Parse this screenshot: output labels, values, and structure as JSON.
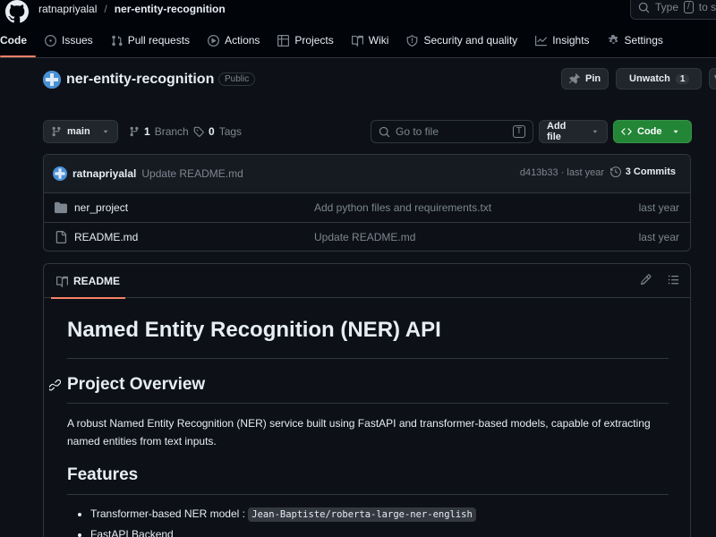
{
  "header": {
    "owner": "ratnapriyalal",
    "separator": "/",
    "repo": "ner-entity-recognition",
    "search_label": "Type",
    "search_key": "/",
    "search_suffix": "to se"
  },
  "tabs": [
    {
      "label": "Code",
      "icon": "code-icon"
    },
    {
      "label": "Issues",
      "icon": "issue-icon"
    },
    {
      "label": "Pull requests",
      "icon": "pull-request-icon"
    },
    {
      "label": "Actions",
      "icon": "play-icon"
    },
    {
      "label": "Projects",
      "icon": "table-icon"
    },
    {
      "label": "Wiki",
      "icon": "book-icon"
    },
    {
      "label": "Security and quality",
      "icon": "shield-icon"
    },
    {
      "label": "Insights",
      "icon": "graph-icon"
    },
    {
      "label": "Settings",
      "icon": "gear-icon"
    }
  ],
  "repo": {
    "name": "ner-entity-recognition",
    "visibility": "Public",
    "pin_label": "Pin",
    "watch_label": "Unwatch",
    "watch_count": "1"
  },
  "branch_bar": {
    "branch": "main",
    "branch_count": "1",
    "branch_label": "Branch",
    "tag_count": "0",
    "tag_label": "Tags",
    "goto_placeholder": "Go to file",
    "goto_key": "T",
    "add_file_label": "Add file",
    "code_label": "Code"
  },
  "commit": {
    "author": "ratnapriyalal",
    "message": "Update README.md",
    "meta": "d413b33 · last year",
    "commits_label": "3 Commits"
  },
  "files": [
    {
      "name": "ner_project",
      "type": "folder",
      "message": "Add python files and requirements.txt",
      "date": "last year"
    },
    {
      "name": "README.md",
      "type": "file",
      "message": "Update README.md",
      "date": "last year"
    }
  ],
  "readme": {
    "tab_label": "README",
    "title": "Named Entity Recognition (NER) API",
    "overview_heading": "Project Overview",
    "overview_text": "A robust Named Entity Recognition (NER) service built using FastAPI and transformer-based models, capable of extracting named entities from text inputs.",
    "features_heading": "Features",
    "features": [
      {
        "text": "Transformer-based NER model : ",
        "code": "Jean-Baptiste/roberta-large-ner-english"
      },
      {
        "text": "FastAPI Backend",
        "code": ""
      }
    ]
  },
  "colors": {
    "background": "#0d1117",
    "accent_green": "#238636",
    "active_tab": "#f78166",
    "muted": "#7d8590",
    "border": "#30363d"
  }
}
